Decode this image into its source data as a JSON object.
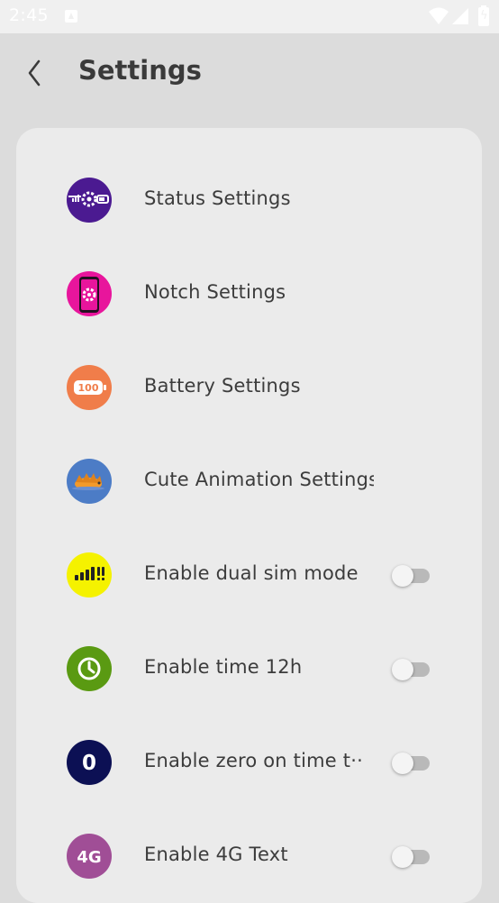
{
  "status_bar": {
    "time": "2:45",
    "icons": [
      "notification-icon",
      "wifi-icon",
      "signal-icon",
      "battery-charging-icon"
    ]
  },
  "header": {
    "back_icon": "chevron-left-icon",
    "title": "Settings"
  },
  "settings": {
    "items": [
      {
        "label": "Status Settings",
        "icon": "status-bar-gear-icon",
        "color": "#4b1a91",
        "has_toggle": false
      },
      {
        "label": "Notch Settings",
        "icon": "phone-gear-icon",
        "color": "#e8159c",
        "has_toggle": false
      },
      {
        "label": "Battery Settings",
        "icon": "battery-100-icon",
        "color": "#f07d4a",
        "battery_text": "100",
        "has_toggle": false
      },
      {
        "label": "Cute Animation Settings",
        "icon": "cute-animal-icon",
        "color": "#4c7cc6",
        "has_toggle": false
      },
      {
        "label": "Enable dual sim mode",
        "icon": "dual-sim-signal-icon",
        "color": "#f5f200",
        "has_toggle": true,
        "toggle_on": false
      },
      {
        "label": "Enable time 12h",
        "icon": "clock-icon",
        "color": "#5a9a12",
        "has_toggle": true,
        "toggle_on": false
      },
      {
        "label": "Enable zero on time t··",
        "icon": "zero-icon",
        "color": "#0c1054",
        "icon_text": "0",
        "has_toggle": true,
        "toggle_on": false
      },
      {
        "label": "Enable 4G Text",
        "icon": "4g-icon",
        "color": "#a04e96",
        "icon_text": "4G",
        "has_toggle": true,
        "toggle_on": false
      }
    ]
  }
}
